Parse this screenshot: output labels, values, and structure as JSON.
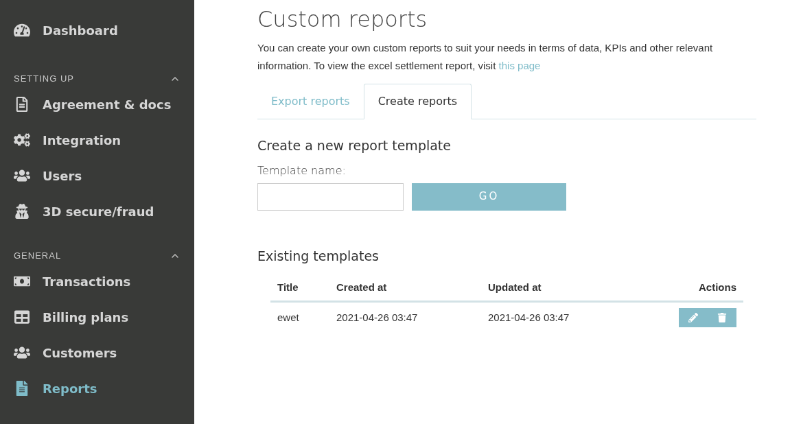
{
  "sidebar": {
    "items": [
      {
        "label": "Dashboard",
        "selected": false
      }
    ],
    "sections": [
      {
        "label": "SETTING UP",
        "expanded": true,
        "items": [
          {
            "label": "Agreement & docs",
            "selected": false
          },
          {
            "label": "Integration",
            "selected": false
          },
          {
            "label": "Users",
            "selected": false
          },
          {
            "label": "3D secure/fraud",
            "selected": false
          }
        ]
      },
      {
        "label": "GENERAL",
        "expanded": true,
        "items": [
          {
            "label": "Transactions",
            "selected": false
          },
          {
            "label": "Billing plans",
            "selected": false
          },
          {
            "label": "Customers",
            "selected": false
          },
          {
            "label": "Reports",
            "selected": true
          }
        ]
      }
    ]
  },
  "page": {
    "title": "Custom reports",
    "intro": "You can create your own custom reports to suit your needs in terms of data, KPIs and other relevant information. To view the excel settlement report, visit",
    "intro_link": "this page"
  },
  "tabs": [
    {
      "label": "Export reports",
      "selected": false
    },
    {
      "label": "Create reports",
      "selected": true
    }
  ],
  "create": {
    "heading": "Create a new report template",
    "field_label": "Template name:",
    "button": "GO"
  },
  "existing": {
    "heading": "Existing templates",
    "columns": [
      "Title",
      "Created at",
      "Updated at",
      "Actions"
    ],
    "rows": [
      {
        "title": "ewet",
        "created": "2021-04-26 03:47",
        "updated": "2021-04-26 03:47"
      }
    ]
  }
}
